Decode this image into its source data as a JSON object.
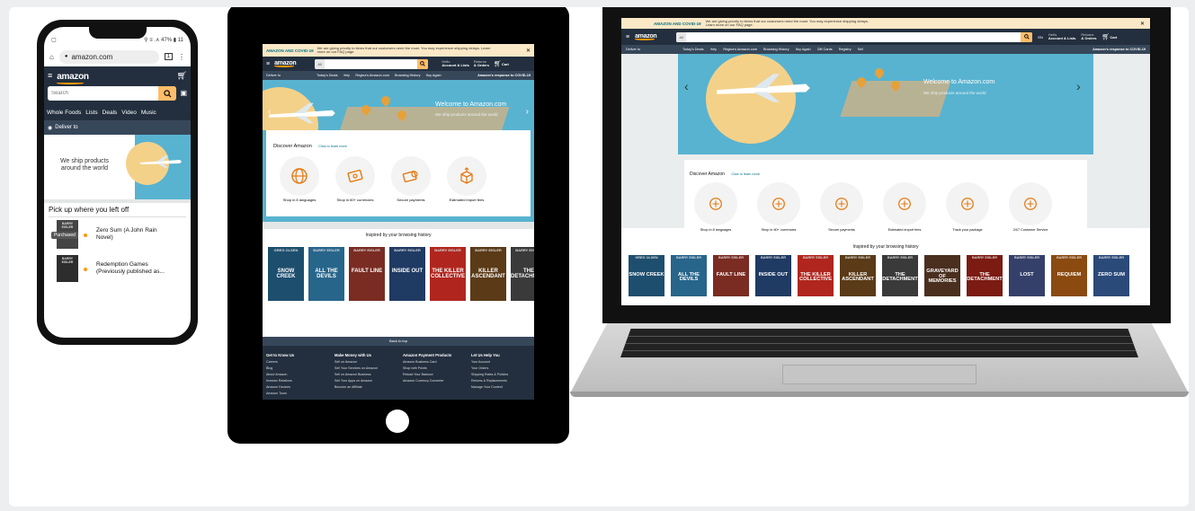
{
  "phone": {
    "status_bar": "⚲ ≡ .∧ 47% ▮ 11",
    "url": "amazon.com",
    "tab_count": "1",
    "logo": "amazon",
    "search_placeholder": "Search",
    "nav_items": [
      "Whole Foods",
      "Lists",
      "Deals",
      "Video",
      "Music"
    ],
    "deliver_to": "Deliver to",
    "hero_text": "We ship products around the world",
    "section_title": "Pick up where you left off",
    "items": [
      {
        "title": "Zero Sum (A John Rain Novel)",
        "badge": "Purchased"
      },
      {
        "title": "Redemption Games (Previously published as...",
        "badge": ""
      }
    ]
  },
  "tablet": {
    "covid_title": "AMAZON AND COVID-19",
    "covid_text": "We are giving priority to items that our customers need the most. You may experience shipping delays. Learn more on our FAQ page.",
    "logo": "amazon",
    "search_scope": "All",
    "account_line1": "Hello",
    "account_line2": "Account & Lists",
    "returns_line1": "Returns",
    "returns_line2": "& Orders",
    "cart": "Cart",
    "deliver_to": "Deliver to",
    "nav_items": [
      "Today's Deals",
      "Help",
      "Regina's Amazon.com",
      "Browsing History",
      "Buy Again"
    ],
    "covid_response": "Amazon's response to COVID-19",
    "hero_title": "Welcome to Amazon.com",
    "hero_sub": "We ship products around the world",
    "discover_title": "Discover Amazon",
    "discover_link": "Click to learn more",
    "features": [
      "Shop in 8 languages",
      "Shop in 60+ currencies",
      "Secure payments",
      "Estimated import fees"
    ],
    "history_title": "Inspired by your browsing history",
    "back_to_top": "Back to top",
    "footer_cols": [
      {
        "title": "Get to Know Us",
        "links": [
          "Careers",
          "Blog",
          "About Amazon",
          "Investor Relations",
          "Amazon Devices",
          "Amazon Tours"
        ]
      },
      {
        "title": "Make Money with Us",
        "links": [
          "Sell on Amazon",
          "Sell Your Services on Amazon",
          "Sell on Amazon Business",
          "Sell Your Apps on Amazon",
          "Become an Affiliate"
        ]
      },
      {
        "title": "Amazon Payment Products",
        "links": [
          "Amazon Business Card",
          "Shop with Points",
          "Reload Your Balance",
          "Amazon Currency Converter"
        ]
      },
      {
        "title": "Let Us Help You",
        "links": [
          "Your Account",
          "Your Orders",
          "Shipping Rates & Policies",
          "Returns & Replacements",
          "Manage Your Content"
        ]
      }
    ]
  },
  "laptop": {
    "covid_title": "AMAZON AND COVID-19",
    "covid_text": "We are giving priority to items that our customers need the most. You may experience shipping delays. Learn more on our FAQ page.",
    "logo": "amazon",
    "search_scope": "All",
    "lang": "EN",
    "account_line1": "Hello,",
    "account_line2": "Account & Lists",
    "returns_line1": "Returns",
    "returns_line2": "& Orders",
    "cart": "Cart",
    "deliver_to": "Deliver to",
    "nav_items": [
      "Today's Deals",
      "Help",
      "Regina's Amazon.com",
      "Browsing History",
      "Buy Again",
      "Gift Cards",
      "Registry",
      "Sell"
    ],
    "covid_response": "Amazon's response to COVID-19",
    "hero_title": "Welcome to Amazon.com",
    "hero_sub": "We ship products around the world",
    "discover_title": "Discover Amazon",
    "discover_link": "Click to learn more",
    "features": [
      "Shop in 8 languages",
      "Shop in 60+ currencies",
      "Secure payments",
      "Estimated import fees",
      "Track your package",
      "24/7 Customer Service"
    ],
    "history_title": "Inspired by your browsing history"
  },
  "books": [
    {
      "author": "GREG OLSEN",
      "title": "SNOW CREEK",
      "color": "#1d4e6e"
    },
    {
      "author": "BARRY EISLER",
      "title": "ALL THE DEVILS",
      "color": "#27658b"
    },
    {
      "author": "BARRY EISLER",
      "title": "FAULT LINE",
      "color": "#7a2c22"
    },
    {
      "author": "BARRY EISLER",
      "title": "INSIDE OUT",
      "color": "#1f3a63"
    },
    {
      "author": "BARRY EISLER",
      "title": "THE KILLER COLLECTIVE",
      "color": "#b0261e"
    },
    {
      "author": "BARRY EISLER",
      "title": "KILLER ASCENDANT",
      "color": "#5a3a17"
    },
    {
      "author": "BARRY EISLER",
      "title": "THE DETACHMENT",
      "color": "#3a3a3a"
    },
    {
      "author": "",
      "title": "GRAVEYARD OF MEMORIES",
      "color": "#4a2f1f"
    },
    {
      "author": "BARRY EISLER",
      "title": "THE DETACHMENT",
      "color": "#7b1b12"
    },
    {
      "author": "BARRY EISLER",
      "title": "LOST",
      "color": "#35406a"
    },
    {
      "author": "BARRY EISLER",
      "title": "REQUIEM",
      "color": "#8a4a10"
    },
    {
      "author": "BARRY EISLER",
      "title": "ZERO SUM",
      "color": "#2a4a7a"
    }
  ]
}
